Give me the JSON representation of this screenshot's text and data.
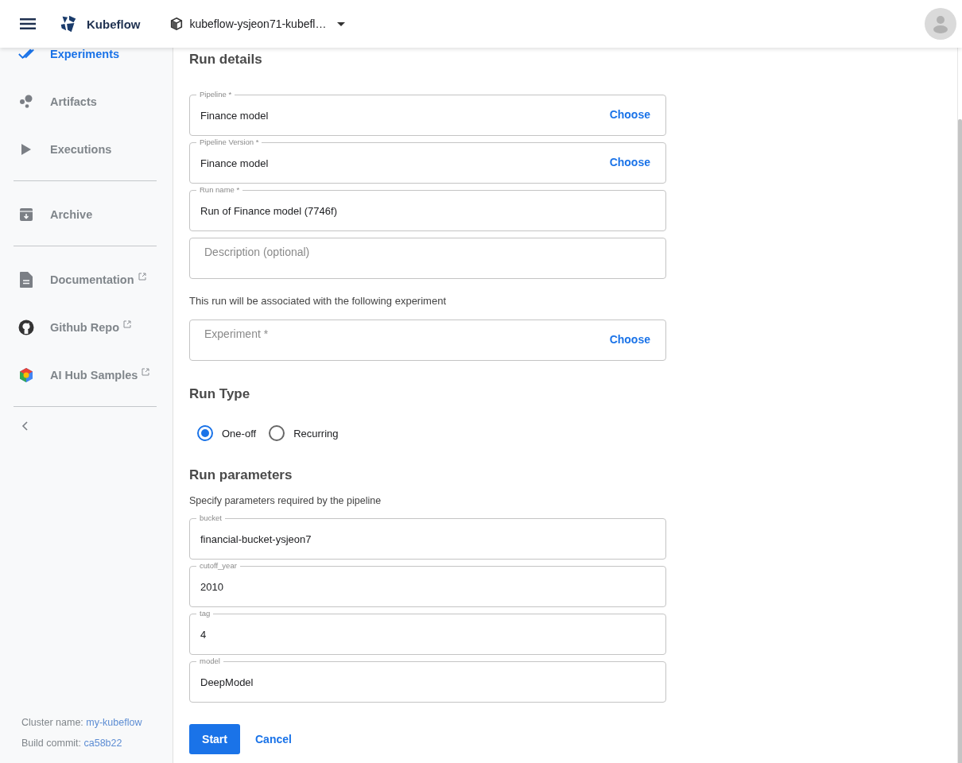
{
  "header": {
    "brand": "Kubeflow",
    "namespace": "kubeflow-ysjeon71-kubefl…"
  },
  "sidebar": {
    "groups": [
      {
        "items": [
          {
            "label": "Experiments",
            "selected": true,
            "external": false
          },
          {
            "label": "Artifacts",
            "selected": false,
            "external": false
          },
          {
            "label": "Executions",
            "selected": false,
            "external": false
          }
        ]
      },
      {
        "items": [
          {
            "label": "Archive",
            "selected": false,
            "external": false
          }
        ]
      },
      {
        "items": [
          {
            "label": "Documentation",
            "selected": false,
            "external": true
          },
          {
            "label": "Github Repo",
            "selected": false,
            "external": true
          },
          {
            "label": "AI Hub Samples",
            "selected": false,
            "external": true
          }
        ]
      }
    ],
    "footer": [
      {
        "label": "Cluster name:",
        "value": "my-kubeflow"
      },
      {
        "label": "Build commit:",
        "value": "ca58b22"
      }
    ]
  },
  "run_details": {
    "title": "Run details",
    "fields": [
      {
        "label": "Pipeline *",
        "value": "Finance model",
        "action": "Choose"
      },
      {
        "label": "Pipeline Version *",
        "value": "Finance model",
        "action": "Choose"
      },
      {
        "label": "Run name *",
        "value": "Run of Finance model (7746f)"
      },
      {
        "placeholder": "Description (optional)"
      }
    ],
    "experiment_note": "This run will be associated with the following experiment",
    "experiment_field": {
      "placeholder": "Experiment *",
      "action": "Choose"
    }
  },
  "run_type": {
    "title": "Run Type",
    "options": [
      {
        "label": "One-off",
        "selected": true
      },
      {
        "label": "Recurring",
        "selected": false
      }
    ]
  },
  "run_parameters": {
    "title": "Run parameters",
    "note": "Specify parameters required by the pipeline",
    "fields": [
      {
        "label": "bucket",
        "value": "financial-bucket-ysjeon7"
      },
      {
        "label": "cutoff_year",
        "value": "2010"
      },
      {
        "label": "tag",
        "value": "4"
      },
      {
        "label": "model",
        "value": "DeepModel"
      }
    ]
  },
  "buttons": {
    "start": "Start",
    "cancel": "Cancel"
  }
}
